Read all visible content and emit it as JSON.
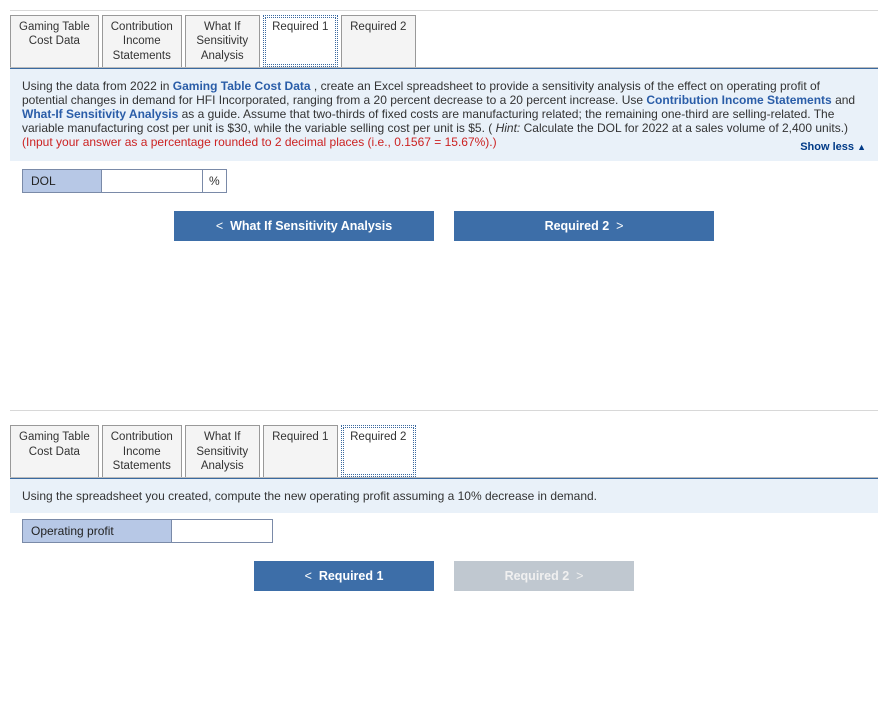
{
  "section1": {
    "tabs": [
      {
        "label": "Gaming Table\nCost Data"
      },
      {
        "label": "Contribution\nIncome\nStatements"
      },
      {
        "label": "What If\nSensitivity\nAnalysis"
      },
      {
        "label": "Required 1"
      },
      {
        "label": "Required 2"
      }
    ],
    "active_tab_index": 3,
    "instructions": {
      "t0": "Using the data from 2022 in ",
      "link0": "Gaming Table Cost Data",
      "t1": ", create an Excel spreadsheet to provide a sensitivity analysis of the effect on operating profit of potential changes in demand for HFI Incorporated, ranging from a 20 percent decrease to a 20 percent increase. Use ",
      "link1": "Contribution Income Statements",
      "t2": " and ",
      "link2": "What-If Sensitivity Analysis",
      "t3": " as a guide. Assume that two-thirds of fixed costs are manufacturing related; the remaining one-third are selling-related. The variable manufacturing cost per unit is $30, while the variable selling cost per unit is $5. (",
      "hint_label": "Hint:",
      "hint_text": " Calculate the DOL for 2022 at a sales volume of 2,400 units.) ",
      "red": "(Input your answer as a percentage rounded to 2 decimal places (i.e., 0.1567 = 15.67%).)"
    },
    "show_less": "Show less",
    "answer_label": "DOL",
    "unit": "%",
    "prev_btn": "What If Sensitivity Analysis",
    "next_btn": "Required 2"
  },
  "section2": {
    "tabs": [
      {
        "label": "Gaming Table\nCost Data"
      },
      {
        "label": "Contribution\nIncome\nStatements"
      },
      {
        "label": "What If\nSensitivity\nAnalysis"
      },
      {
        "label": "Required 1"
      },
      {
        "label": "Required 2"
      }
    ],
    "active_tab_index": 4,
    "instructions_plain": "Using the spreadsheet you created, compute the new operating profit assuming a 10% decrease in demand.",
    "answer_label": "Operating profit",
    "prev_btn": "Required 1",
    "next_btn": "Required 2"
  }
}
